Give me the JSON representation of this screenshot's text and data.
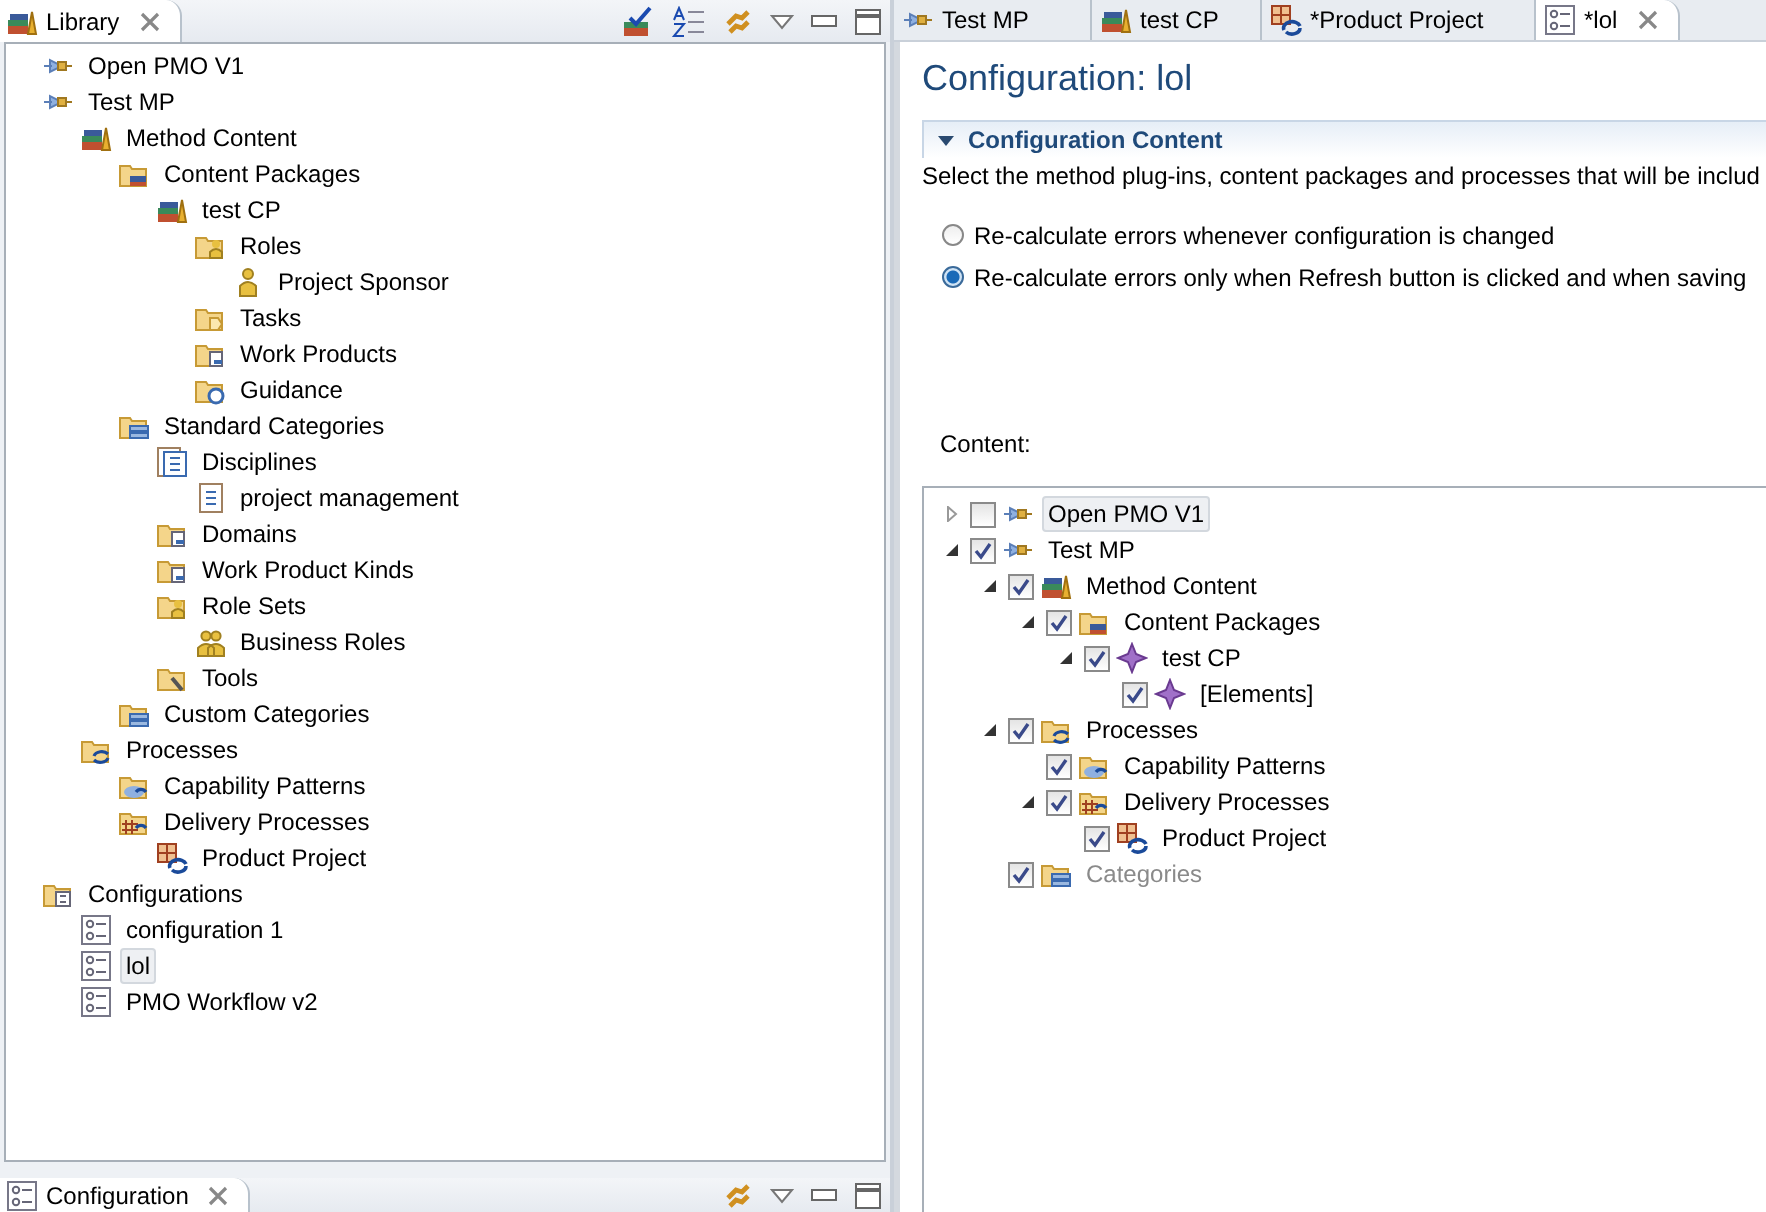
{
  "library_view": {
    "tab": {
      "label": "Library",
      "selected": true
    },
    "tree": [
      {
        "label": "Open PMO V1",
        "kind": "plugin",
        "selected": false
      },
      {
        "label": "Test MP",
        "kind": "plugin",
        "selected": false,
        "children": [
          {
            "label": "Method Content",
            "kind": "books",
            "selected": false,
            "children": [
              {
                "label": "Content Packages",
                "kind": "books-folder",
                "selected": false,
                "children": [
                  {
                    "label": "test CP",
                    "kind": "books",
                    "selected": false,
                    "children": [
                      {
                        "label": "Roles",
                        "kind": "role-folder",
                        "selected": false,
                        "children": [
                          {
                            "label": "Project Sponsor",
                            "kind": "role",
                            "selected": false
                          }
                        ]
                      },
                      {
                        "label": "Tasks",
                        "kind": "task-folder",
                        "selected": false
                      },
                      {
                        "label": "Work Products",
                        "kind": "product-folder",
                        "selected": false
                      },
                      {
                        "label": "Guidance",
                        "kind": "guidance-folder",
                        "selected": false
                      }
                    ]
                  }
                ]
              },
              {
                "label": "Standard Categories",
                "kind": "category-folder",
                "selected": false,
                "children": [
                  {
                    "label": "Disciplines",
                    "kind": "discipline-group",
                    "selected": false,
                    "children": [
                      {
                        "label": "project management",
                        "kind": "discipline",
                        "selected": false
                      }
                    ]
                  },
                  {
                    "label": "Domains",
                    "kind": "product-folder",
                    "selected": false
                  },
                  {
                    "label": "Work Product Kinds",
                    "kind": "product-folder",
                    "selected": false
                  },
                  {
                    "label": "Role Sets",
                    "kind": "role-folder",
                    "selected": false,
                    "children": [
                      {
                        "label": "Business Roles",
                        "kind": "roles",
                        "selected": false
                      }
                    ]
                  },
                  {
                    "label": "Tools",
                    "kind": "tool-folder",
                    "selected": false
                  }
                ]
              },
              {
                "label": "Custom Categories",
                "kind": "category-folder",
                "selected": false
              }
            ]
          },
          {
            "label": "Processes",
            "kind": "process-folder",
            "selected": false,
            "children": [
              {
                "label": "Capability Patterns",
                "kind": "capability-folder",
                "selected": false
              },
              {
                "label": "Delivery Processes",
                "kind": "delivery-folder",
                "selected": false,
                "children": [
                  {
                    "label": "Product Project",
                    "kind": "delivery-process",
                    "selected": false
                  }
                ]
              }
            ]
          }
        ]
      },
      {
        "label": "Configurations",
        "kind": "config-folder",
        "selected": false,
        "children": [
          {
            "label": "configuration 1",
            "kind": "config",
            "selected": false
          },
          {
            "label": "lol",
            "kind": "config",
            "selected": true
          },
          {
            "label": "PMO Workflow v2",
            "kind": "config",
            "selected": false
          }
        ]
      }
    ]
  },
  "editor": {
    "tabs": [
      {
        "label": "Test MP",
        "kind": "plugin",
        "selected": false
      },
      {
        "label": "test CP",
        "kind": "books",
        "selected": false
      },
      {
        "label": "*Product Project",
        "kind": "delivery-process",
        "selected": false
      },
      {
        "label": "*lol",
        "kind": "config",
        "selected": true
      }
    ],
    "title": "Configuration: lol",
    "section": {
      "title": "Configuration Content",
      "expanded": true,
      "description": "Select the method plug-ins, content packages and processes that will be includ",
      "options": [
        {
          "label": "Re-calculate errors whenever configuration is changed",
          "selected": false
        },
        {
          "label": "Re-calculate errors only when Refresh button is clicked and when saving",
          "selected": true
        }
      ],
      "content_label": "Content:",
      "tree": [
        {
          "label": "Open PMO V1",
          "kind": "plugin",
          "expanded": false,
          "checked": false,
          "disabled": false,
          "selected": true
        },
        {
          "label": "Test MP",
          "kind": "plugin",
          "expanded": true,
          "checked": true,
          "disabled": false,
          "selected": false,
          "children": [
            {
              "label": "Method Content",
              "kind": "books",
              "expanded": true,
              "checked": true,
              "disabled": false,
              "selected": false,
              "children": [
                {
                  "label": "Content Packages",
                  "kind": "books-folder",
                  "expanded": true,
                  "checked": true,
                  "disabled": false,
                  "selected": false,
                  "children": [
                    {
                      "label": "test CP",
                      "kind": "package",
                      "expanded": true,
                      "checked": true,
                      "disabled": false,
                      "selected": false,
                      "children": [
                        {
                          "label": "[Elements]",
                          "kind": "package",
                          "checked": true,
                          "disabled": false,
                          "selected": false
                        }
                      ]
                    }
                  ]
                }
              ]
            },
            {
              "label": "Processes",
              "kind": "process-folder",
              "expanded": true,
              "checked": true,
              "disabled": false,
              "selected": false,
              "children": [
                {
                  "label": "Capability Patterns",
                  "kind": "capability-folder",
                  "checked": true,
                  "disabled": false,
                  "selected": false
                },
                {
                  "label": "Delivery Processes",
                  "kind": "delivery-folder",
                  "expanded": true,
                  "checked": true,
                  "disabled": false,
                  "selected": false,
                  "children": [
                    {
                      "label": "Product Project",
                      "kind": "delivery-process",
                      "checked": true,
                      "disabled": false,
                      "selected": false
                    }
                  ]
                }
              ]
            },
            {
              "label": "Categories",
              "kind": "category-folder",
              "checked": true,
              "disabled": true,
              "selected": false
            }
          ]
        }
      ]
    }
  },
  "config_view": {
    "tab": {
      "label": "Configuration",
      "selected": true
    }
  }
}
